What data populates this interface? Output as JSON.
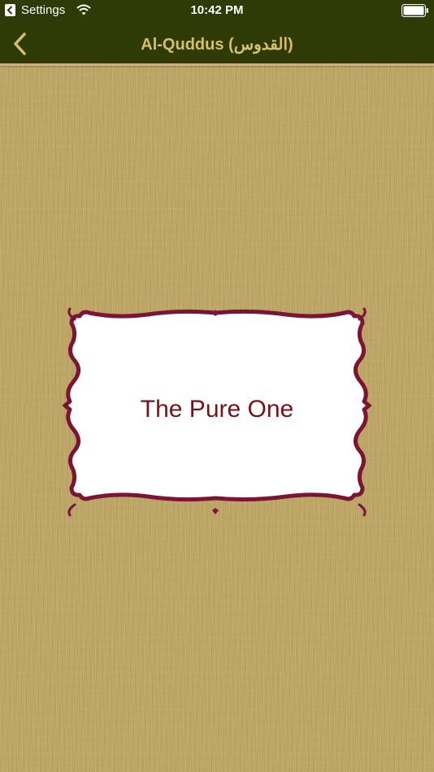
{
  "status_bar": {
    "back_app_label": "Settings",
    "time": "10:42 PM",
    "icons": [
      "back-arrow-icon",
      "wifi-icon",
      "battery-icon"
    ]
  },
  "nav_bar": {
    "back_icon": "chevron-left-icon",
    "title": "Al-Quddus (القدوس)"
  },
  "card": {
    "meaning": "The Pure One"
  },
  "colors": {
    "nav_background": "#2e3b07",
    "title_gold": "#d7bf6a",
    "frame_maroon": "#7c1535",
    "meaning_text": "#7a1116",
    "background_texture": "#bea766"
  }
}
